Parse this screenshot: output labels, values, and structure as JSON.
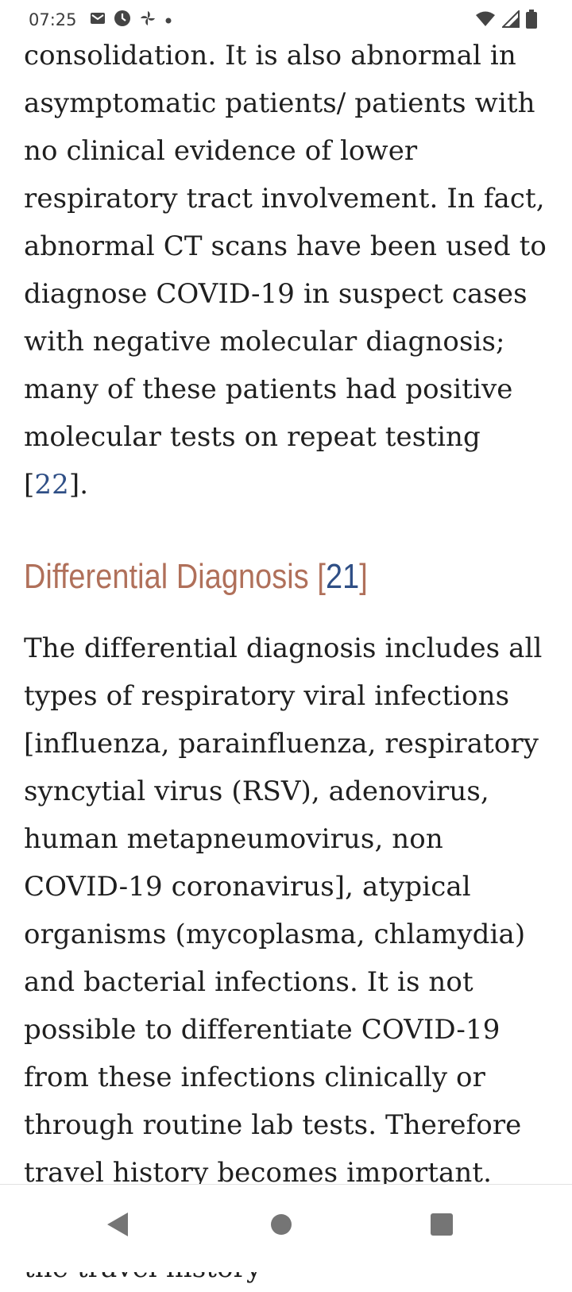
{
  "status_bar": {
    "time": "07:25",
    "left_icons": [
      "gmail-icon",
      "clock-icon",
      "pinwheel-icon",
      "notification-dot-icon"
    ],
    "right_icons": [
      "wifi-icon",
      "cellular-signal-icon",
      "battery-icon"
    ]
  },
  "article": {
    "paragraph1": {
      "text": "consolidation. It is also abnormal in asymptomatic patients/ patients with no clinical evidence of lower respiratory tract involvement. In fact, abnormal CT scans have been used to diagnose COVID-19 in suspect cases with negative molecular diagnosis; many of these patients had positive molecular tests on repeat testing [",
      "ref": "22",
      "tail": "]."
    },
    "heading": {
      "text": "Differential Diagnosis [",
      "ref": "21",
      "tail": "]"
    },
    "paragraph2": {
      "text": "The differential diagnosis includes all types of respiratory viral infections [influenza, parainfluenza, respiratory syncytial virus (RSV), adenovirus, human metapneumovirus, non COVID-19 coronavirus], atypical organisms (mycoplasma, chlamydia) and bacterial infections. It is not possible to differentiate COVID-19 from these infections clinically or through routine lab tests. Therefore travel history becomes important. However, as the epidemic spreads, the travel history"
    }
  },
  "nav_bar": {
    "buttons": [
      "back-icon",
      "home-icon",
      "recents-icon"
    ]
  },
  "colors": {
    "heading": "#b0705a",
    "reference_link": "#2f4f86",
    "body_text": "#1f1f1f"
  }
}
